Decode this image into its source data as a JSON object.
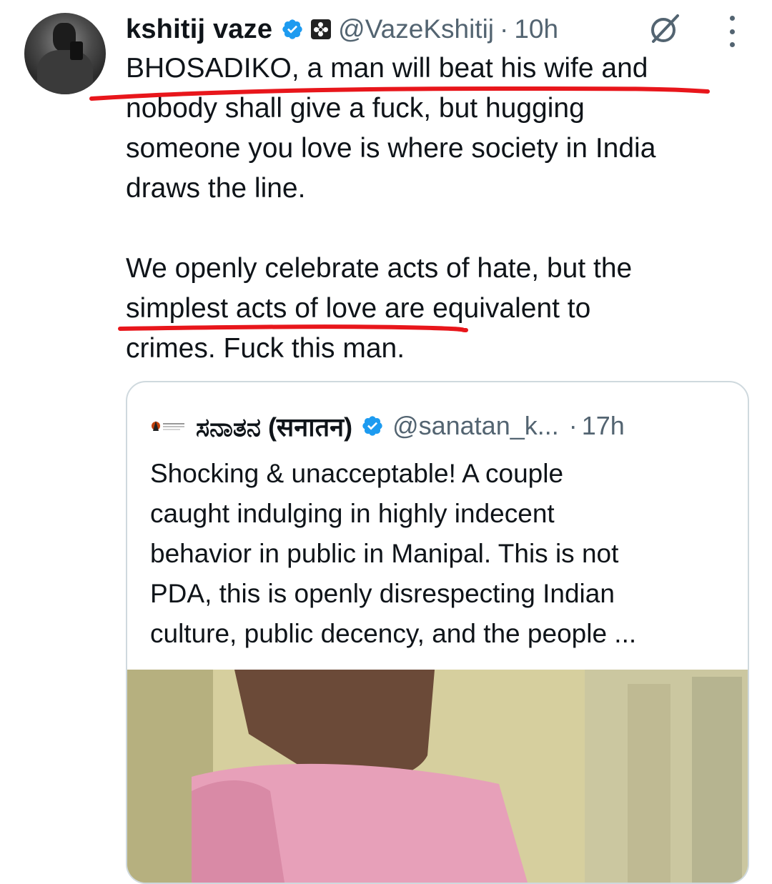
{
  "author": {
    "name": "kshitij vaze",
    "handle": "@VazeKshitij",
    "separator": "·",
    "time": "10h"
  },
  "tweet": {
    "paragraph1": [
      "BHOSADIKO, a man will beat his wife and",
      "nobody shall give a fuck, but hugging",
      "someone you love is where society in India",
      "draws the line."
    ],
    "paragraph2": [
      "We openly celebrate acts of hate, but the",
      "simplest acts of love are equivalent to",
      "crimes. Fuck this man."
    ]
  },
  "quoted": {
    "name": "ಸನಾತನ (सनातन)",
    "handle": "@sanatan_k...",
    "separator": "·",
    "time": "17h",
    "lines": [
      "Shocking & unacceptable! A couple",
      "caught indulging in highly indecent",
      "behavior in public in Manipal. This is not",
      "PDA, this is openly disrespecting Indian",
      "culture, public decency, and the people ..."
    ]
  },
  "colors": {
    "verified": "#1d9bf0",
    "annotation": "#e8161b",
    "secondary_text": "#536471",
    "border": "#cfd9de"
  },
  "icons": [
    "verified-badge-icon",
    "affiliate-badge-icon",
    "grok-icon",
    "more-options-icon"
  ]
}
